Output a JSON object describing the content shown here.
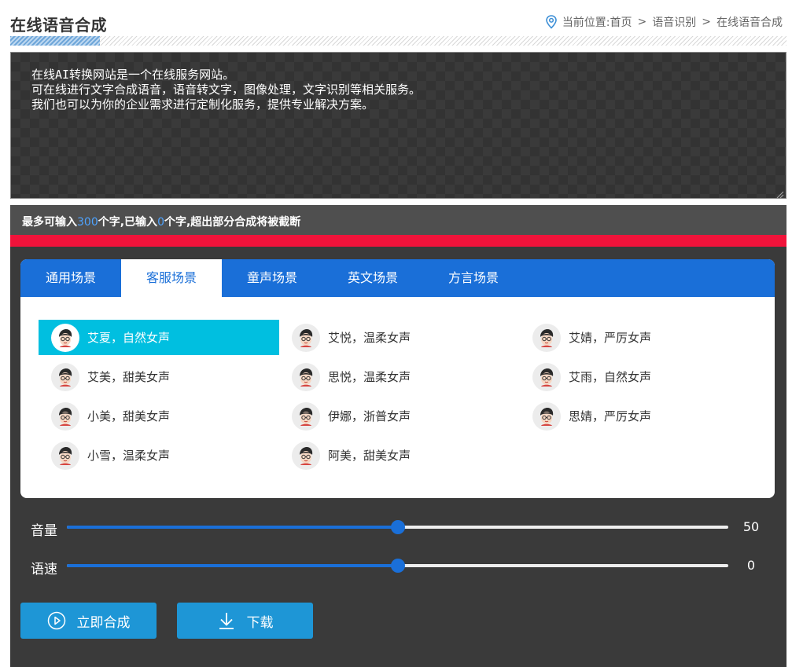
{
  "header": {
    "title": "在线语音合成",
    "breadcrumb_prefix": "当前位置: ",
    "breadcrumb": [
      "首页",
      "语音识别",
      "在线语音合成"
    ],
    "separator": ">"
  },
  "text_input": {
    "lines": [
      "在线AI转换网站是一个在线服务网站。",
      "可在线进行文字合成语音，语音转文字，图像处理，文字识别等相关服务。",
      "我们也可以为你的企业需求进行定制化服务，提供专业解决方案。"
    ]
  },
  "counter": {
    "prefix": "最多可输入",
    "max": "300",
    "middle": "个字,已输入",
    "current": "0",
    "suffix": "个字,超出部分合成将被截断"
  },
  "tabs": [
    {
      "label": "通用场景",
      "active": false
    },
    {
      "label": "客服场景",
      "active": true
    },
    {
      "label": "童声场景",
      "active": false
    },
    {
      "label": "英文场景",
      "active": false
    },
    {
      "label": "方言场景",
      "active": false
    }
  ],
  "voices": [
    {
      "label": "艾夏，自然女声",
      "selected": true
    },
    {
      "label": "艾悦，温柔女声",
      "selected": false
    },
    {
      "label": "艾婧，严厉女声",
      "selected": false
    },
    {
      "label": "艾美，甜美女声",
      "selected": false
    },
    {
      "label": "思悦，温柔女声",
      "selected": false
    },
    {
      "label": "艾雨，自然女声",
      "selected": false
    },
    {
      "label": "小美，甜美女声",
      "selected": false
    },
    {
      "label": "伊娜，浙普女声",
      "selected": false
    },
    {
      "label": "思婧，严厉女声",
      "selected": false
    },
    {
      "label": "小雪，温柔女声",
      "selected": false
    },
    {
      "label": "阿美，甜美女声",
      "selected": false
    }
  ],
  "sliders": {
    "volume": {
      "label": "音量",
      "value": "50",
      "fraction": 0.5
    },
    "speed": {
      "label": "语速",
      "value": "0",
      "fraction": 0.5
    }
  },
  "buttons": {
    "synthesize": "立即合成",
    "download": "下载"
  },
  "colors": {
    "accent": "#1a6fd8",
    "selected_voice": "#00bfe0",
    "alert_bar": "#f0133a",
    "button": "#1e96d6",
    "counter_number": "#4ea3ff"
  },
  "icons": {
    "location": "location-pin-icon",
    "avatar": "avatar-icon",
    "play": "play-circle-icon",
    "download": "download-icon"
  }
}
